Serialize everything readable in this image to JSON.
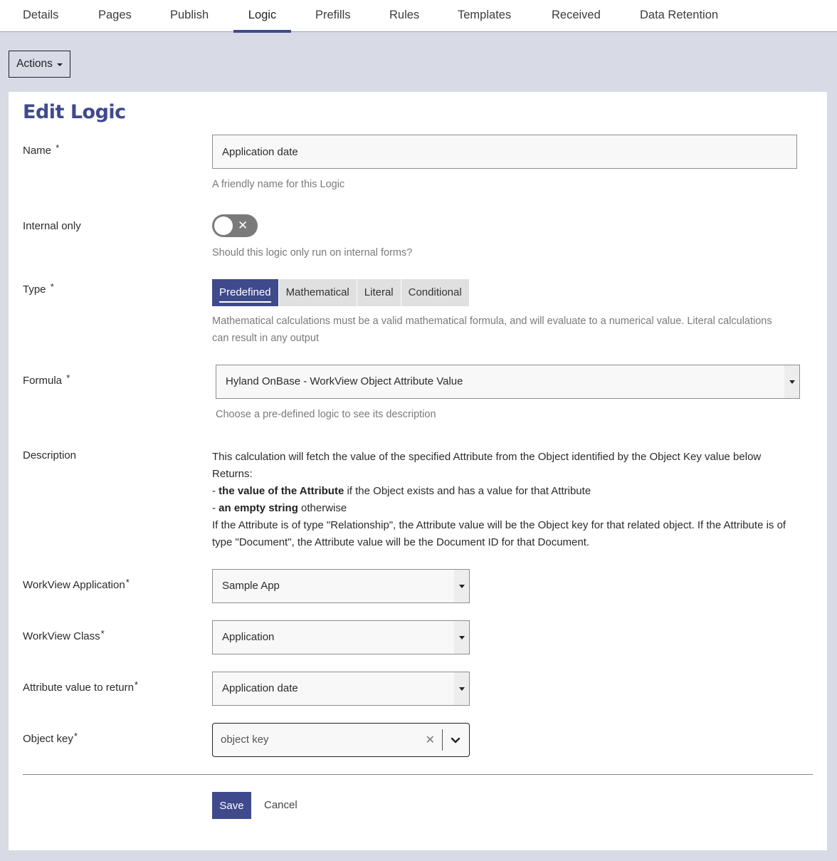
{
  "tabs": [
    {
      "label": "Details"
    },
    {
      "label": "Pages"
    },
    {
      "label": "Publish"
    },
    {
      "label": "Logic",
      "active": true
    },
    {
      "label": "Prefills"
    },
    {
      "label": "Rules"
    },
    {
      "label": "Templates"
    },
    {
      "label": "Received"
    },
    {
      "label": "Data Retention"
    }
  ],
  "actions_label": "Actions",
  "page_title": "Edit Logic",
  "form": {
    "name": {
      "label": "Name",
      "required_mark": "*",
      "value": "Application date",
      "help": "A friendly name for this Logic"
    },
    "internal_only": {
      "label": "Internal only",
      "checked": false,
      "toggle_glyph": "✕",
      "help": "Should this logic only run on internal forms?"
    },
    "type": {
      "label": "Type",
      "required_mark": "*",
      "options": [
        "Predefined",
        "Mathematical",
        "Literal",
        "Conditional"
      ],
      "selected": "Predefined",
      "help": "Mathematical calculations must be a valid mathematical formula, and will evaluate to a numerical value. Literal calculations can result in any output"
    },
    "formula": {
      "label": "Formula",
      "required_mark": "*",
      "value": "Hyland OnBase - WorkView Object Attribute Value",
      "help": "Choose a pre-defined logic to see its description"
    },
    "description": {
      "label": "Description",
      "line1": "This calculation will fetch the value of the specified Attribute from the Object identified by the Object Key value below",
      "line2": "Returns:",
      "bullet1_prefix": "- ",
      "bullet1_bold": "the value of the Attribute",
      "bullet1_rest": " if the Object exists and has a value for that Attribute",
      "bullet2_prefix": "- ",
      "bullet2_bold": "an empty string",
      "bullet2_rest": " otherwise",
      "line3": "If the Attribute is of type \"Relationship\", the Attribute value will be the Object key for that related object. If the Attribute is of type \"Document\", the Attribute value will be the Document ID for that Document."
    },
    "workview_application": {
      "label": "WorkView Application",
      "required_mark": "*",
      "value": "Sample App"
    },
    "workview_class": {
      "label": "WorkView Class",
      "required_mark": "*",
      "value": "Application"
    },
    "attribute_value": {
      "label": "Attribute value to return",
      "required_mark": "*",
      "value": "Application date"
    },
    "object_key": {
      "label": "Object key",
      "required_mark": "*",
      "placeholder": "object key",
      "clear_glyph": "✕"
    }
  },
  "buttons": {
    "save": "Save",
    "cancel": "Cancel"
  },
  "colors": {
    "accent": "#3f4a8c",
    "page_background": "#d8dae6",
    "toggle_off": "#7a7a7a"
  }
}
